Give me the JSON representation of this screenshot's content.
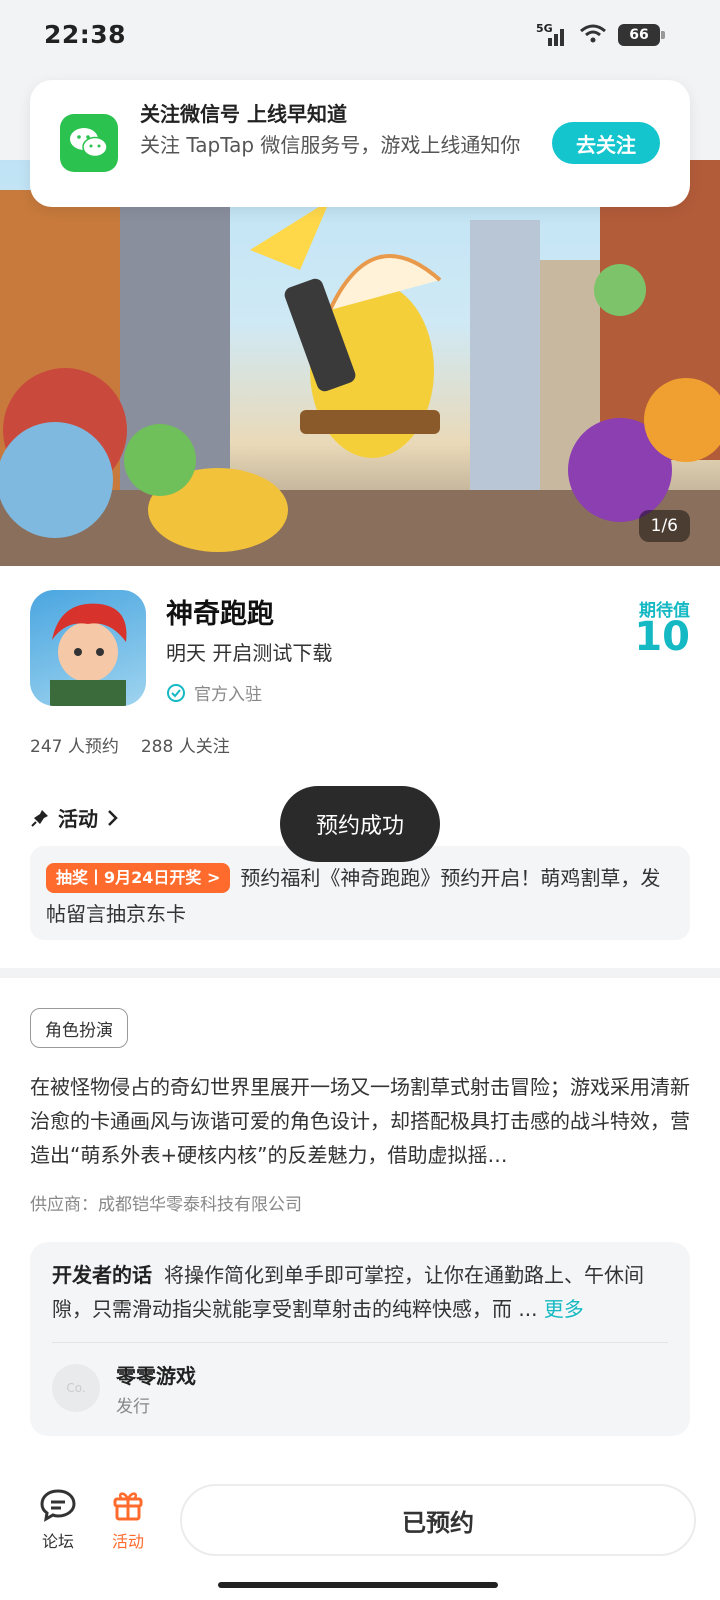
{
  "status_bar": {
    "time": "22:38",
    "network": "5G",
    "battery": "66"
  },
  "notification": {
    "title": "关注微信号 上线早知道",
    "body": "关注 TapTap 微信服务号，游戏上线通知你",
    "button": "去关注",
    "icon": "wechat-icon"
  },
  "hero": {
    "page_indicator": "1/6"
  },
  "game": {
    "title": "神奇跑跑",
    "release": "明天 开启测试下载",
    "official": "官方入驻",
    "expect_label": "期待值",
    "expect_value": "10",
    "reservations": "247 人预约",
    "followers": "288 人关注"
  },
  "activity": {
    "header": "活动",
    "badge": "抽奖丨9月24日开奖 >",
    "text": "预约福利《神奇跑跑》预约开启！萌鸡割草，发帖留言抽京东卡"
  },
  "toast": "预约成功",
  "tag": "角色扮演",
  "description": "在被怪物侵占的奇幻世界里展开一场又一场割草式射击冒险；游戏采用清新治愈的卡通画风与诙谐可爱的角色设计，却搭配极具打击感的战斗特效，营造出“萌系外表+硬核内核”的反差魅力，借助虚拟摇…",
  "supplier": "供应商：成都铠华零泰科技有限公司",
  "developer": {
    "label": "开发者的话",
    "text": "将操作简化到单手即可掌控，让你在通勤路上、午休间隙，只需滑动指尖就能享受割草射击的纯粹快感，而 ...",
    "more": "更多",
    "publisher_avatar": "Co.",
    "publisher_name": "零零游戏",
    "publisher_role": "发行"
  },
  "bottom_nav": {
    "forum": "论坛",
    "activity": "活动",
    "reserved": "已预约"
  },
  "colors": {
    "accent": "#15c5ce",
    "orange": "#ff6b2c",
    "wechat": "#2bc24f"
  }
}
